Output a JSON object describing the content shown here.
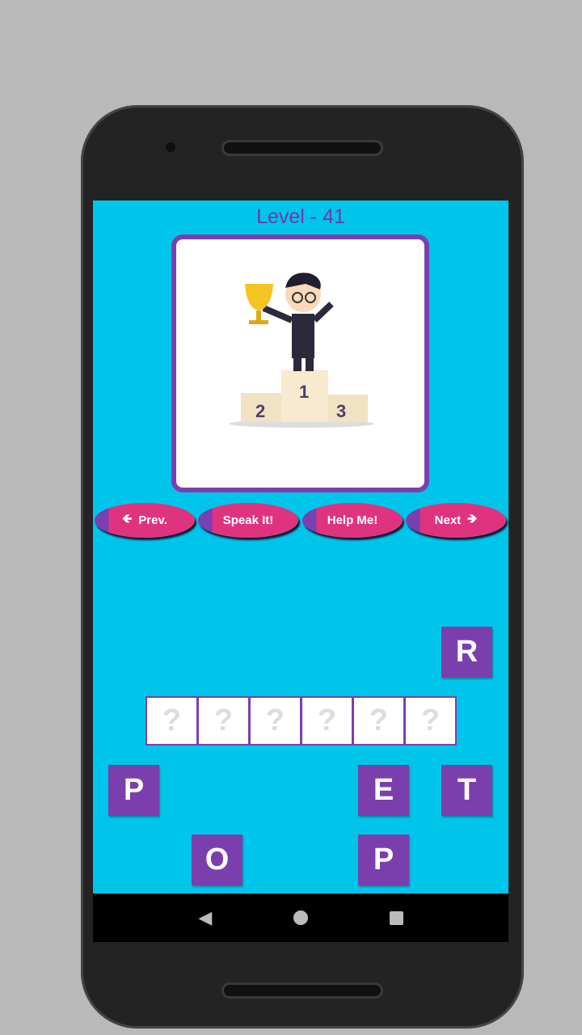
{
  "header": {
    "level": "Level - 41"
  },
  "puzzle": {
    "image": "trophy-winner-podium",
    "podium_numbers": [
      "1",
      "2",
      "3"
    ]
  },
  "buttons": {
    "prev": "Prev.",
    "speak": "Speak It!",
    "help": "Help Me!",
    "next": "Next"
  },
  "answer_slots": [
    "?",
    "?",
    "?",
    "?",
    "?",
    "?"
  ],
  "letter_tiles": [
    "R",
    "P",
    "E",
    "T",
    "O",
    "P"
  ],
  "colors": {
    "background": "#00c5ea",
    "accent": "#7b3fad",
    "button": "#e0337f"
  }
}
